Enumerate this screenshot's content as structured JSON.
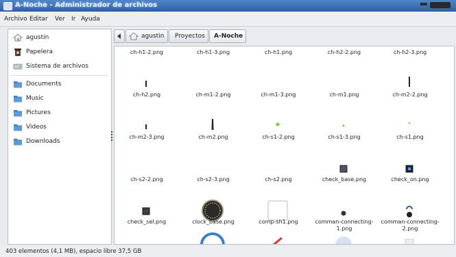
{
  "window": {
    "title": "A-Noche - Administrador de archivos"
  },
  "menubar": {
    "items": [
      "Archivo",
      "Editar",
      "Ver",
      "Ir",
      "Ayuda"
    ]
  },
  "sidebar": {
    "places": [
      {
        "label": "agustin",
        "icon": "home-icon"
      },
      {
        "label": "Papelera",
        "icon": "trash-icon"
      },
      {
        "label": "Sistema de archivos",
        "icon": "drive-icon"
      }
    ],
    "bookmarks": [
      {
        "label": "Documents",
        "icon": "folder-icon"
      },
      {
        "label": "Music",
        "icon": "folder-icon"
      },
      {
        "label": "Pictures",
        "icon": "folder-icon"
      },
      {
        "label": "Videos",
        "icon": "folder-icon"
      },
      {
        "label": "Downloads",
        "icon": "folder-icon"
      }
    ]
  },
  "pathbar": {
    "back_icon": "left-arrow-icon",
    "segments": [
      "agustin",
      "Proyectos",
      "A-Noche"
    ],
    "active": "A-Noche"
  },
  "files": [
    [
      "ch-h1-2.png",
      "ch-h1-3.png",
      "ch-h1.png",
      "ch-h2-2.png",
      "ch-h2-3.png"
    ],
    [
      "ch-h2.png",
      "ch-m1-2.png",
      "ch-m1-3.png",
      "ch-m1.png",
      "ch-m2-2.png"
    ],
    [
      "ch-m2-3.png",
      "ch-m2.png",
      "ch-s1-2.png",
      "ch-s1-3.png",
      "ch-s1.png"
    ],
    [
      "ch-s2-2.png",
      "ch-s2-3.png",
      "ch-s2.png",
      "check_base.png",
      "check_on.png"
    ],
    [
      "check_sel.png",
      "clock_base.png",
      "comp-sh1.png",
      "comman-connecting-1.png",
      "comman-connecting-2.png"
    ]
  ],
  "status": {
    "text": "403 elementos (4,1 MB), espacio libre 37,5 GB"
  },
  "colors": {
    "titlebar": "#3a6fb0",
    "accent_green": "#6ad13a",
    "folder_blue": "#3d7fc6"
  }
}
